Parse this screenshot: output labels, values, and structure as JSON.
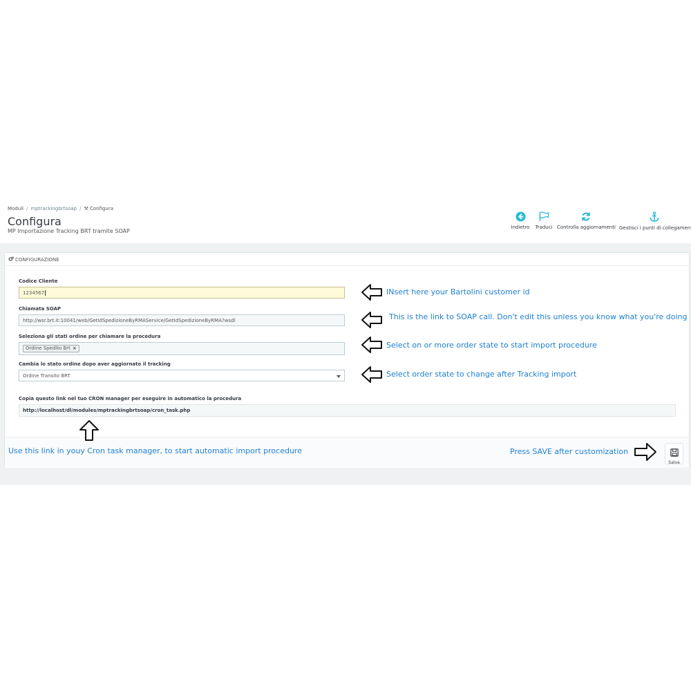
{
  "breadcrumb": [
    "Moduli",
    "mptrackingbrtsoap",
    "Configura"
  ],
  "page": {
    "title": "Configura",
    "subtitle": "MP Importazione Tracking BRT tramite SOAP"
  },
  "toolbar": {
    "back_label": "Indietro",
    "translate_label": "Traduci",
    "updates_label": "Controlla aggiornamenti",
    "hooks_label": "Gestisci i punti di collegamento"
  },
  "panel": {
    "heading": "CONFIGURAZIONE",
    "fields": {
      "customer_code": {
        "label": "Codice Cliente",
        "value": "1234567"
      },
      "soap_call": {
        "label": "Chiamata SOAP",
        "value": "http://wsr.brt.it:10041/web/GetIdSpedizioneByRMAService/GetIdSpedizioneByRMA?wsdl"
      },
      "order_states": {
        "label": "Seleziona gli stati ordine per chiamare la procedura",
        "selected_tag": "Ordine Spedito Brt",
        "remove": "×"
      },
      "change_state": {
        "label": "Cambia lo stato ordine dopo aver aggiornato il tracking",
        "selected": "Ordine Transito BRT"
      },
      "cron_link": {
        "label": "Copia questo link nel tuo CRON manager per eseguire in automatico la procedura",
        "value": "http://localhost/dl/modules/mptrackingbrtsoap/cron_task.php"
      }
    },
    "save_label": "Salva"
  },
  "annotations": {
    "customer_id": "INsert here your Bartolini customer id",
    "soap_link": "This is the link to SOAP call. Don't edit this unless you know what you're doing",
    "order_state": "Select on or more order state to start import procedure",
    "change_state": "Select order state to change after Tracking import",
    "cron": "Use this link in youy Cron task manager, to start automatic import procedure",
    "save": "Press SAVE after customization"
  },
  "colors": {
    "accent": "#25b9d7",
    "annotation": "#1e7fd0",
    "active_input": "#fffbd8"
  },
  "icons": [
    "back-circle-icon",
    "flag-icon",
    "refresh-icon",
    "anchor-icon",
    "cogs-icon",
    "floppy-icon",
    "arrow-left-icon",
    "arrow-up-icon",
    "arrow-right-icon"
  ]
}
